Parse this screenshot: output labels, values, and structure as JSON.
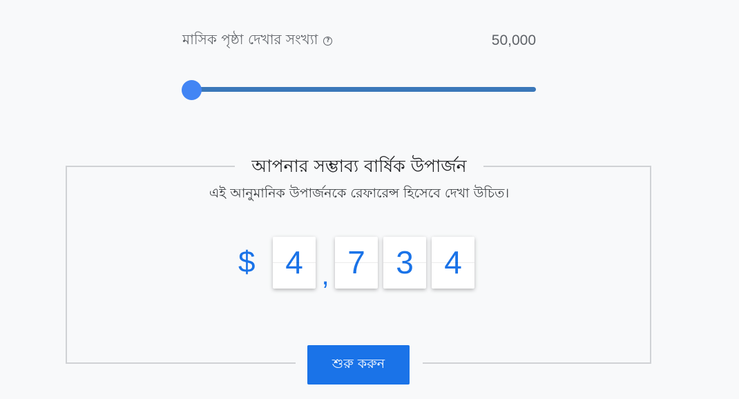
{
  "slider": {
    "label": "মাসিক পৃষ্ঠা দেখার সংখ্যা",
    "help_icon": "question-mark-circle",
    "value": "50,000",
    "position": 0.0
  },
  "earnings": {
    "title": "আপনার সম্ভাব্য বার্ষিক উপার্জন",
    "note": "এই আনুমানিক উপার্জনকে রেফারেন্স হিসেবে দেখা উচিত।",
    "currency": "$",
    "digits": [
      "4",
      "7",
      "3",
      "4"
    ],
    "separator": ","
  },
  "cta": {
    "label": "শুরু করুন"
  },
  "colors": {
    "accent": "#1a73e8",
    "slider_thumb": "#4285f4",
    "slider_track": "#3b78b9",
    "background": "#f8f9fa"
  }
}
